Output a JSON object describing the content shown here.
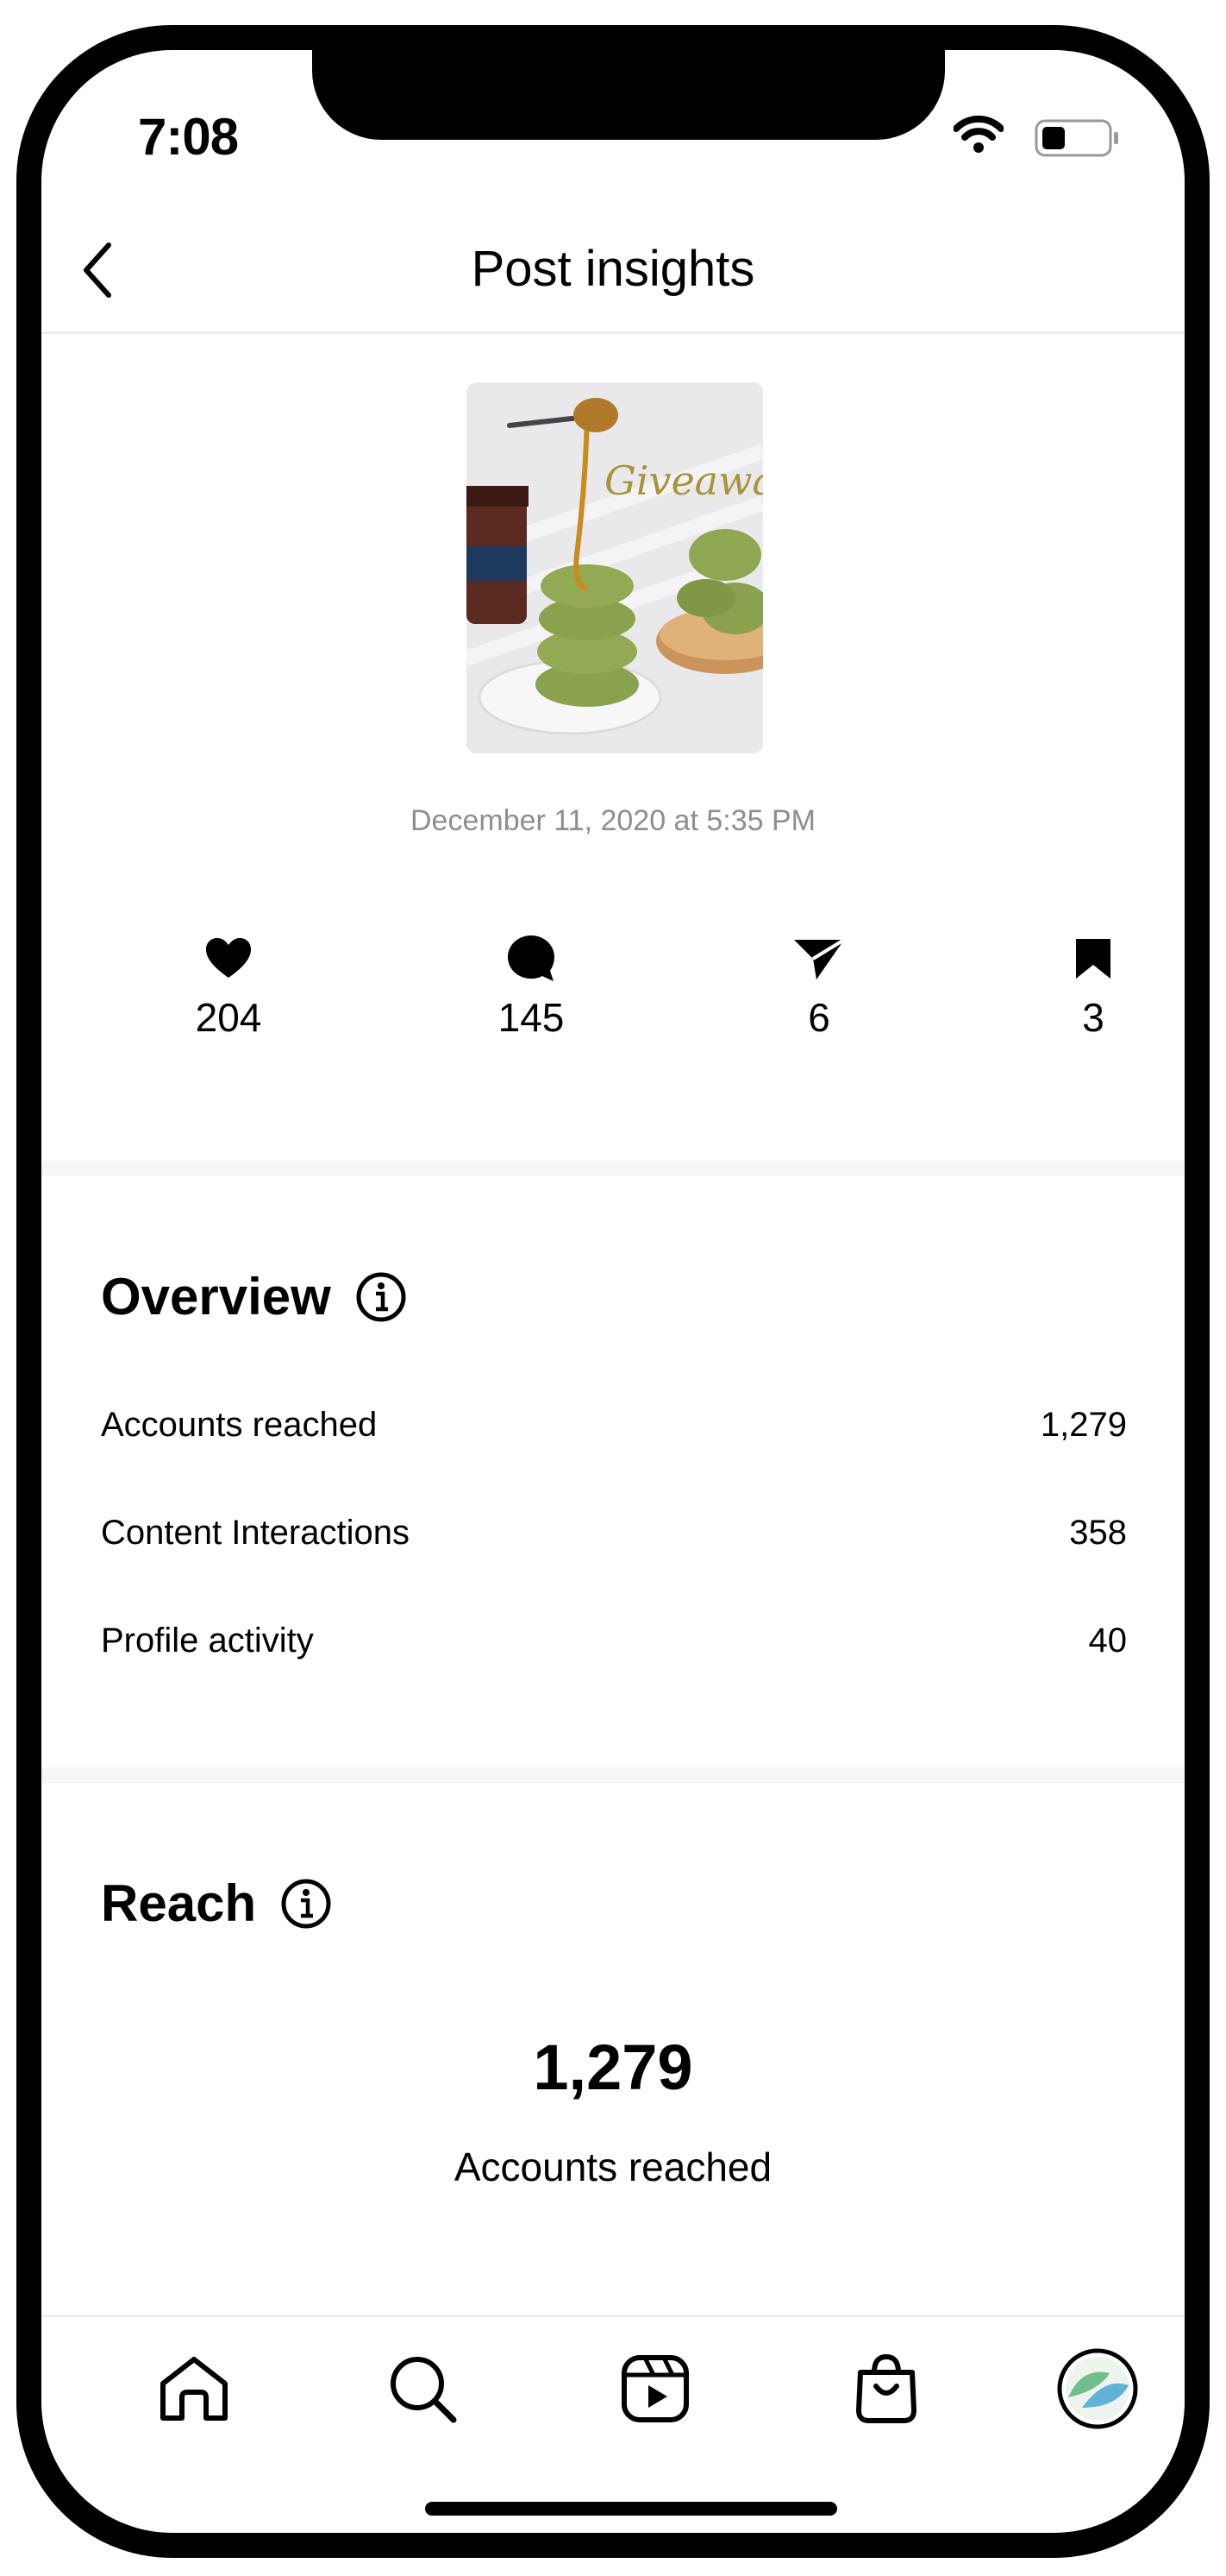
{
  "status_bar": {
    "time": "7:08"
  },
  "header": {
    "title": "Post insights"
  },
  "post": {
    "date": "December 11, 2020 at 5:35 PM"
  },
  "stats": {
    "likes": "204",
    "comments": "145",
    "shares": "6",
    "saves": "3"
  },
  "overview": {
    "title": "Overview",
    "rows": [
      {
        "label": "Accounts reached",
        "value": "1,279"
      },
      {
        "label": "Content Interactions",
        "value": "358"
      },
      {
        "label": "Profile activity",
        "value": "40"
      }
    ]
  },
  "reach": {
    "title": "Reach",
    "value": "1,279",
    "label": "Accounts reached"
  },
  "icons": {
    "back": "chevron-left-icon",
    "likes": "heart-icon",
    "comments": "comment-icon",
    "shares": "paper-plane-icon",
    "saves": "bookmark-icon",
    "info": "info-icon",
    "tabs": [
      "home-icon",
      "search-icon",
      "reels-icon",
      "shop-icon",
      "profile-avatar"
    ]
  },
  "colors": {
    "muted": "#8e8e8e",
    "divider": "#ececec",
    "section_bg": "#f6f6f6"
  }
}
